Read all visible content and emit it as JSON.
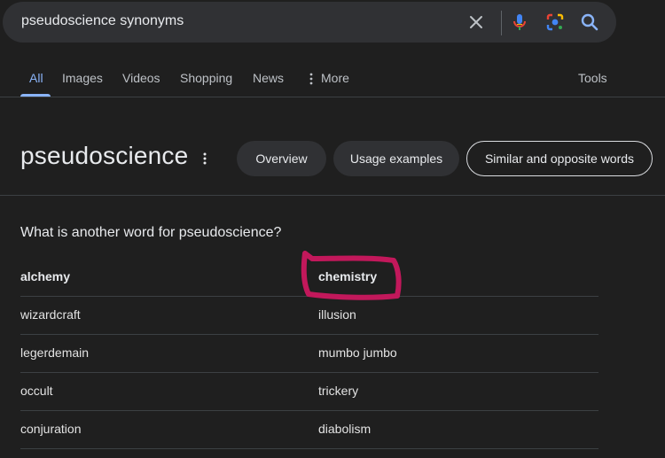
{
  "search": {
    "query": "pseudoscience synonyms"
  },
  "icons": {
    "clear": "close-icon",
    "voice": "microphone-icon",
    "lens": "google-lens-icon",
    "search": "search-icon"
  },
  "colors": {
    "accent": "#8ab4f8",
    "annotation": "#c2185b"
  },
  "tabs": [
    {
      "label": "All",
      "active": true
    },
    {
      "label": "Images"
    },
    {
      "label": "Videos"
    },
    {
      "label": "Shopping"
    },
    {
      "label": "News"
    },
    {
      "label": "More"
    }
  ],
  "tools_label": "Tools",
  "word": {
    "title": "pseudoscience",
    "buttons": {
      "overview": "Overview",
      "usage": "Usage examples",
      "similar": "Similar and opposite words"
    }
  },
  "synonyms": {
    "question": "What is another word for pseudoscience?",
    "rows": [
      [
        "alchemy",
        "chemistry"
      ],
      [
        "wizardcraft",
        "illusion"
      ],
      [
        "legerdemain",
        "mumbo jumbo"
      ],
      [
        "occult",
        "trickery"
      ],
      [
        "conjuration",
        "diabolism"
      ]
    ]
  }
}
